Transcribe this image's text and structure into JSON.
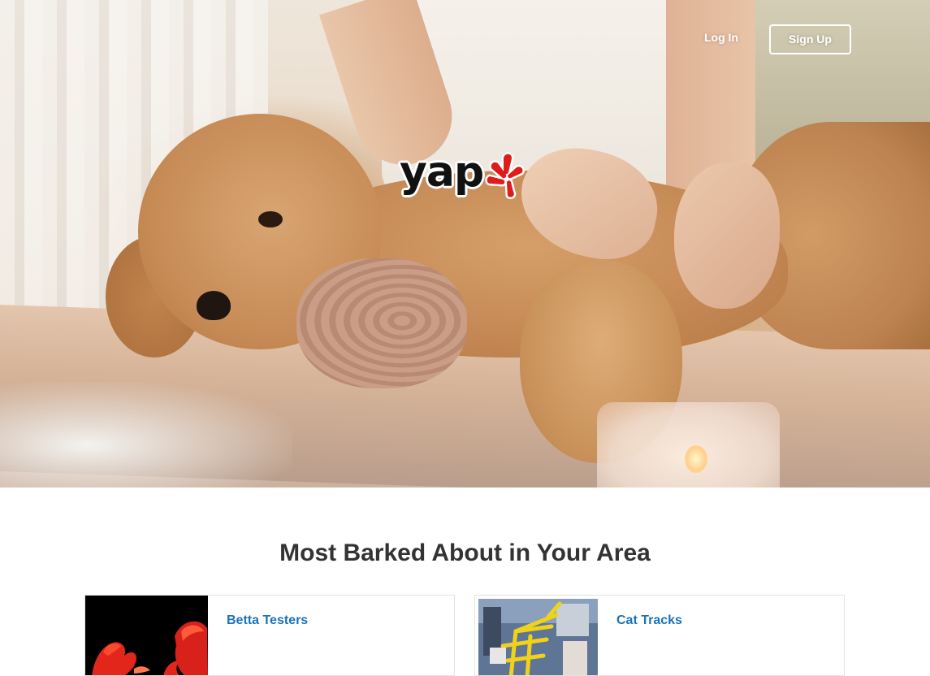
{
  "nav": {
    "login_label": "Log In",
    "signup_label": "Sign Up"
  },
  "hero": {
    "logo_text": "yap",
    "logo_accent_color": "#e01b1b",
    "image_subject": "poodle-massage-photo"
  },
  "section": {
    "title": "Most Barked About in Your Area"
  },
  "businesses": [
    {
      "name": "Betta Testers",
      "image": "betta-fish-photo"
    },
    {
      "name": "Cat Tracks",
      "image": "cat-climbing-structure-photo"
    }
  ],
  "colors": {
    "link": "#1a73b5",
    "heading": "#333333",
    "card_border": "#e3e3e3"
  }
}
